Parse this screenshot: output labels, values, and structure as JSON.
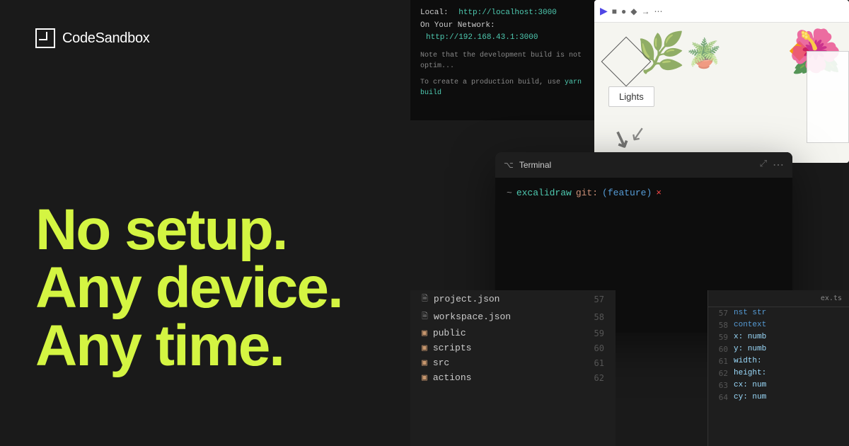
{
  "brand": {
    "logo_text": "CodeSandbox",
    "logo_icon_symbol": "□"
  },
  "tagline": {
    "line1": "No setup.",
    "line2": "Any device.",
    "line3": "Any time."
  },
  "devserver": {
    "line1_label": "Local:",
    "line1_url": "http://localhost:3000",
    "line2_label": "On Your Network:",
    "line2_url": "http://192.168.43.1:3000",
    "note1": "Note that the development build is not optim...",
    "note2": "To create a production build, use yarn build"
  },
  "terminal": {
    "title": "Terminal",
    "prompt": "~",
    "directory": "excalidraw",
    "branch_prefix": "git:",
    "branch": "(feature)",
    "cursor": "×"
  },
  "design_panel": {
    "lights_label": "Lights"
  },
  "explorer": {
    "items": [
      {
        "type": "file",
        "name": "project.json",
        "line": "57"
      },
      {
        "type": "file",
        "name": "workspace.json",
        "line": "58"
      },
      {
        "type": "folder",
        "name": "public",
        "line": "59"
      },
      {
        "type": "folder",
        "name": "scripts",
        "line": "60"
      },
      {
        "type": "folder",
        "name": "src",
        "line": "61"
      },
      {
        "type": "folder",
        "name": "actions",
        "line": "62"
      }
    ]
  },
  "code_panel": {
    "filename": "ex.ts",
    "lines": [
      {
        "num": "57",
        "content": "nst str"
      },
      {
        "num": "58",
        "content": "context"
      },
      {
        "num": "59",
        "content": "x: numb"
      },
      {
        "num": "60",
        "content": "y: numb"
      },
      {
        "num": "61",
        "content": "width:"
      },
      {
        "num": "62",
        "content": "height:"
      },
      {
        "num": "63",
        "content": "cx: num"
      },
      {
        "num": "64",
        "content": "cy: num"
      }
    ]
  }
}
